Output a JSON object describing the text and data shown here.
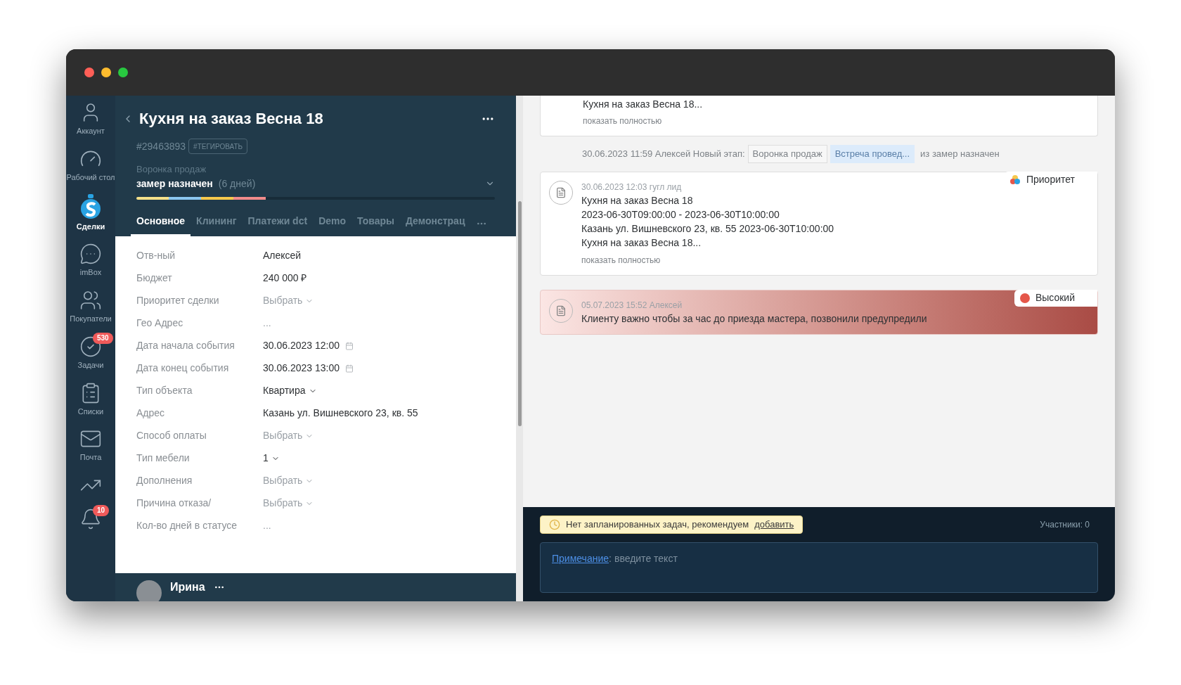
{
  "sidebar": {
    "items": [
      {
        "kind": "account",
        "label": "Аккаунт",
        "selected": false
      },
      {
        "kind": "dashboard",
        "label": "Рабочий стол",
        "selected": false
      },
      {
        "kind": "deals",
        "label": "Сделки",
        "selected": true
      },
      {
        "kind": "inbox",
        "label": "imBox",
        "selected": false
      },
      {
        "kind": "customers",
        "label": "Покупатели",
        "selected": false
      },
      {
        "kind": "tasks",
        "label": "Задачи",
        "badge": "530",
        "selected": false
      },
      {
        "kind": "lists",
        "label": "Списки",
        "selected": false
      },
      {
        "kind": "mail",
        "label": "Почта",
        "selected": false
      },
      {
        "kind": "analytics",
        "selected": false
      },
      {
        "kind": "notifications",
        "badge": "10",
        "selected": false
      }
    ]
  },
  "lead": {
    "title": "Кухня на заказ Весна 18",
    "id": "#29463893",
    "tag_button": "#ТЕГИРОВАТЬ",
    "pipeline": "Воронка продаж",
    "stage": "замер назначен",
    "stage_duration": "(6 дней)",
    "stage_segments": [
      {
        "color": "#f4e08a"
      },
      {
        "color": "#8cc7f0"
      },
      {
        "color": "#f5c84c"
      },
      {
        "color": "#f28b8b"
      }
    ],
    "tabs": [
      {
        "label": "Основное",
        "selected": true
      },
      {
        "label": "Клининг",
        "selected": false
      },
      {
        "label": "Платежи dct",
        "selected": false
      },
      {
        "label": "Demo",
        "selected": false
      },
      {
        "label": "Товары",
        "selected": false
      },
      {
        "label": "Демонстрац",
        "selected": false
      }
    ],
    "fields": [
      {
        "label": "Отв-ный",
        "value": "Алексей",
        "kind": "text"
      },
      {
        "label": "Бюджет",
        "value": "240 000 ₽",
        "kind": "text"
      },
      {
        "label": "Приоритет сделки",
        "placeholder": "Выбрать",
        "kind": "select"
      },
      {
        "label": "Гео Адрес",
        "placeholder": "...",
        "kind": "text"
      },
      {
        "label": "Дата начала события",
        "value": "30.06.2023 12:00",
        "kind": "date"
      },
      {
        "label": "Дата конец события",
        "value": "30.06.2023 13:00",
        "kind": "date"
      },
      {
        "label": "Тип объекта",
        "value": "Квартира",
        "kind": "select"
      },
      {
        "label": "Адрес",
        "value": "Казань ул. Вишневского 23, кв. 55",
        "kind": "text"
      },
      {
        "label": "Способ оплаты",
        "placeholder": "Выбрать",
        "kind": "select"
      },
      {
        "label": "Тип мебели",
        "value": "1",
        "kind": "select"
      },
      {
        "label": "Дополнения",
        "placeholder": "Выбрать",
        "kind": "select"
      },
      {
        "label": "Причина отказа/",
        "placeholder": "Выбрать",
        "kind": "select"
      },
      {
        "label": "Кол-во дней в статусе",
        "placeholder": "...",
        "kind": "text"
      }
    ],
    "contact": {
      "name": "Ирина"
    }
  },
  "feed": {
    "top_card": {
      "line": "Кухня на заказ Весна 18...",
      "show_more": "показать полностью"
    },
    "event": {
      "text": "30.06.2023 11:59 Алексей Новый этап:",
      "chips": [
        "Воронка продаж",
        "Встреча провед..."
      ],
      "suffix": "из замер назначен"
    },
    "notes": [
      {
        "meta": "30.06.2023 12:03 гугл лид",
        "lines": [
          "Кухня на заказ Весна 18",
          "2023-06-30T09:00:00 - 2023-06-30T10:00:00",
          "Казань ул. Вишневского 23, кв. 55 2023-06-30T10:00:00",
          "Кухня на заказ Весна 18..."
        ],
        "show_more": "показать полностью",
        "badge": {
          "label": "Приоритет",
          "kind": "priority"
        }
      },
      {
        "meta": "05.07.2023 15:52 Алексей",
        "lines": [
          "Клиенту важно чтобы за час до приезда мастера, позвонили предупредили"
        ],
        "badge": {
          "label": "Высокий",
          "kind": "high",
          "color": "#e5574a"
        }
      }
    ],
    "tasks_hint": {
      "text": "Нет запланированных задач, рекомендуем",
      "link": "добавить"
    },
    "participants": "Участники: 0",
    "composer": {
      "link": "Примечание",
      "separator": ":",
      "placeholder": "введите текст"
    }
  }
}
